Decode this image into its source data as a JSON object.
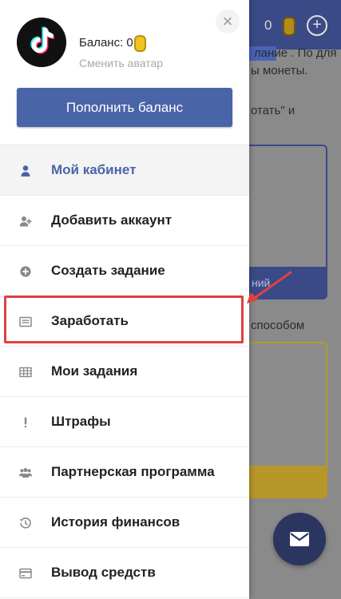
{
  "background": {
    "balance_value": "0",
    "plus_symbol": "+",
    "text_lines": [
      "лание . По для",
      "ы монеты.",
      "отать\" и",
      "способом"
    ],
    "card_text": "ний",
    "colors": {
      "header": "#3a4a86",
      "card_gold": "#b8972a"
    }
  },
  "drawer": {
    "close_symbol": "×",
    "balance_label": "Баланс: 0",
    "change_avatar": "Сменить аватар",
    "topup_button": "Пополнить баланс",
    "menu": [
      {
        "label": "Мой кабинет",
        "icon": "user-icon",
        "active": true
      },
      {
        "label": "Добавить аккаунт",
        "icon": "add-user-icon",
        "active": false
      },
      {
        "label": "Создать задание",
        "icon": "plus-circle-icon",
        "active": false
      },
      {
        "label": "Заработать",
        "icon": "card-list-icon",
        "active": false,
        "highlighted": true
      },
      {
        "label": "Мои задания",
        "icon": "table-icon",
        "active": false
      },
      {
        "label": "Штрафы",
        "icon": "exclamation-icon",
        "active": false
      },
      {
        "label": "Партнерская программа",
        "icon": "users-icon",
        "active": false
      },
      {
        "label": "История финансов",
        "icon": "history-icon",
        "active": false
      },
      {
        "label": "Вывод средств",
        "icon": "credit-card-icon",
        "active": false
      }
    ],
    "colors": {
      "accent": "#4a64a8",
      "highlight": "#e04040"
    }
  },
  "fab": {
    "icon": "mail-icon"
  }
}
